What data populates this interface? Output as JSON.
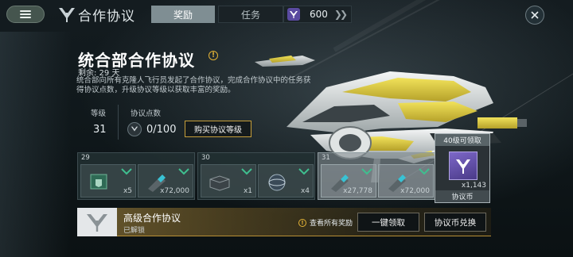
{
  "header": {
    "title": "合作协议",
    "tabs": [
      {
        "label": "奖励",
        "active": true
      },
      {
        "label": "任务",
        "active": false
      }
    ],
    "currency": {
      "amount": "600",
      "icon": "protocol-coin-icon",
      "color": "#5a4aa0"
    }
  },
  "info": {
    "title": "统合部合作协议",
    "remaining": "剩余: 29 天",
    "description": "统合部向所有克隆人飞行员发起了合作协议，完成合作协议中的任务获得协议点数，升级协议等级以获取丰富的奖励。",
    "level_label": "等级",
    "level_value": "31",
    "points_label": "协议点数",
    "points_value": "0/100",
    "buy_button": "购买协议等级"
  },
  "rewards": [
    {
      "level": "29",
      "items": [
        {
          "name": "module-box",
          "qty": "x5"
        },
        {
          "name": "fuel-canister",
          "qty": "x72,000"
        }
      ]
    },
    {
      "level": "30",
      "items": [
        {
          "name": "supply-crate",
          "qty": "x1"
        },
        {
          "name": "blueprint-sphere",
          "qty": "x4"
        }
      ]
    },
    {
      "level": "31",
      "items": [
        {
          "name": "fuel-canister",
          "qty": "x27,778"
        },
        {
          "name": "fuel-canister",
          "qty": "x72,000"
        }
      ]
    }
  ],
  "badge": {
    "header": "40级可领取",
    "count": "x1,143",
    "name": "协议币"
  },
  "bottom": {
    "title": "高级合作协议",
    "status": "已解锁",
    "view_all": "查看所有奖励",
    "claim_all": "一键领取",
    "exchange": "协议币兑换"
  },
  "colors": {
    "accent_gold": "#c79f3a",
    "check_green": "#3fbf8f",
    "warning": "#e2b236"
  }
}
